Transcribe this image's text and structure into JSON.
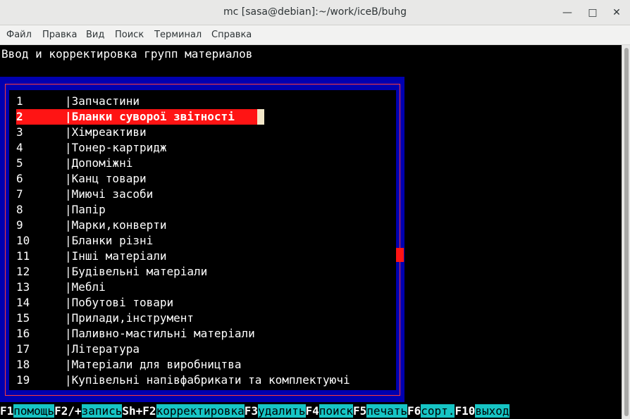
{
  "window": {
    "title": "mc [sasa@debian]:~/work/iceB/buhg",
    "controls": {
      "minimize": "—",
      "maximize": "□",
      "close": "✕"
    }
  },
  "menubar": {
    "items": [
      {
        "label": "Файл"
      },
      {
        "label": "Правка"
      },
      {
        "label": "Вид"
      },
      {
        "label": "Поиск"
      },
      {
        "label": "Терминал"
      },
      {
        "label": "Справка"
      }
    ]
  },
  "screen": {
    "heading": "Ввод и корректировка групп материалов"
  },
  "groups": {
    "rows": [
      {
        "num": "1",
        "name": "|Запчастини"
      },
      {
        "num": "2",
        "name": "|Бланки суворої звітності",
        "selected": true
      },
      {
        "num": "3",
        "name": "|Хімреактиви"
      },
      {
        "num": "4",
        "name": "|Тонер-картридж"
      },
      {
        "num": "5",
        "name": "|Допоміжні"
      },
      {
        "num": "6",
        "name": "|Канц товари"
      },
      {
        "num": "7",
        "name": "|Миючі засоби"
      },
      {
        "num": "8",
        "name": "|Папір"
      },
      {
        "num": "9",
        "name": "|Марки,конверти"
      },
      {
        "num": "10",
        "name": "|Бланки різні"
      },
      {
        "num": "11",
        "name": "|Інші матеріали"
      },
      {
        "num": "12",
        "name": "|Будівельні матеріали"
      },
      {
        "num": "13",
        "name": "|Меблі"
      },
      {
        "num": "14",
        "name": "|Побутові товари"
      },
      {
        "num": "15",
        "name": "|Прилади,інструмент"
      },
      {
        "num": "16",
        "name": "|Паливно-мастильні матеріали"
      },
      {
        "num": "17",
        "name": "|Література"
      },
      {
        "num": "18",
        "name": "|Матеріали для виробництва"
      },
      {
        "num": "19",
        "name": "|Купівельні напівфабрикати та комплектуючі"
      }
    ]
  },
  "fkeys": [
    {
      "key": "F1",
      "label": "помощь"
    },
    {
      "key": "F2/+",
      "label": "запись"
    },
    {
      "key": "Sh+F2",
      "label": "корректировка"
    },
    {
      "key": "F3",
      "label": "удалить"
    },
    {
      "key": "F4",
      "label": "поиск"
    },
    {
      "key": "F5",
      "label": "печать"
    },
    {
      "key": "F6",
      "label": "сорт."
    },
    {
      "key": "F10",
      "label": "выход"
    }
  ],
  "colors": {
    "panel": "#0000b0",
    "selection": "#ff1414",
    "fkey_label_bg": "#16c4c4"
  }
}
